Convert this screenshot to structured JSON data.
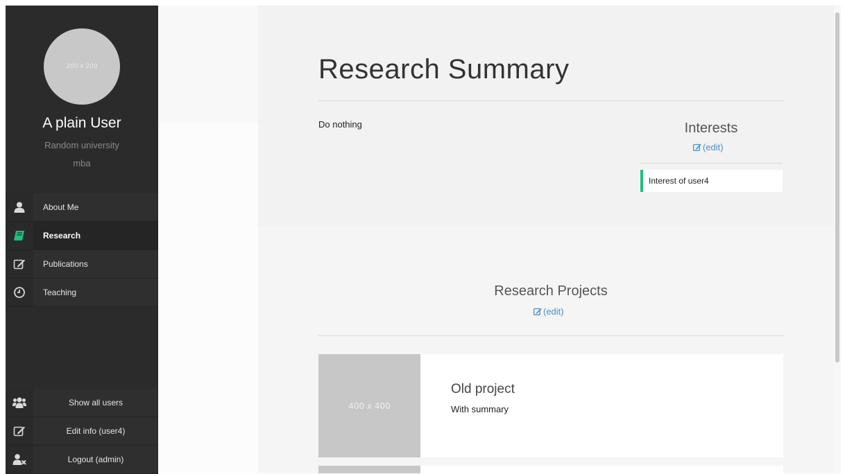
{
  "profile": {
    "avatar_placeholder": "200 x 200",
    "name": "A plain User",
    "university": "Random university",
    "degree": "mba"
  },
  "nav": {
    "items": [
      {
        "label": "About Me",
        "icon": "user-icon",
        "active": false
      },
      {
        "label": "Research",
        "icon": "book-icon",
        "active": true
      },
      {
        "label": "Publications",
        "icon": "edit-icon",
        "active": false
      },
      {
        "label": "Teaching",
        "icon": "clock-icon",
        "active": false
      }
    ]
  },
  "bottom_nav": {
    "items": [
      {
        "label": "Show all users",
        "icon": "users-icon"
      },
      {
        "label": "Edit info (user4)",
        "icon": "edit-icon"
      },
      {
        "label": "Logout (admin)",
        "icon": "user-remove-icon"
      }
    ]
  },
  "main": {
    "title": "Research Summary",
    "summary": "Do nothing",
    "interests": {
      "title": "Interests",
      "edit_label": "(edit)",
      "items": [
        "Interest of user4"
      ]
    },
    "projects": {
      "title": "Research Projects",
      "edit_label": "(edit)",
      "items": [
        {
          "thumb_placeholder": "400 x 400",
          "title": "Old project",
          "summary": "With summary"
        }
      ]
    }
  },
  "colors": {
    "sidebar_bg": "#2b2b2b",
    "accent_green": "#1fbf7d",
    "link_blue": "#4a8ec6"
  }
}
